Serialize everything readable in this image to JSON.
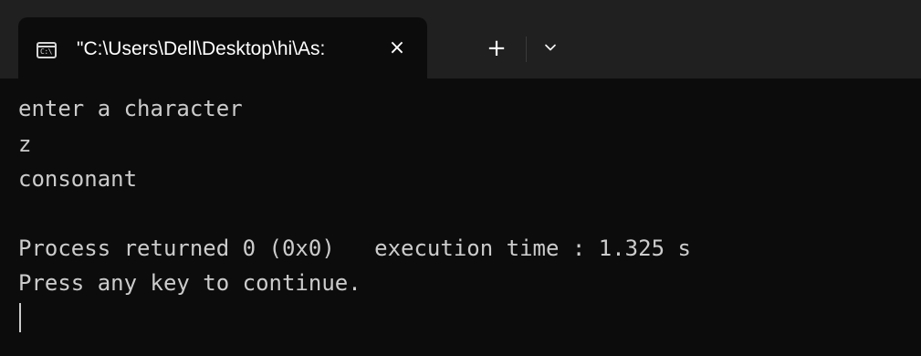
{
  "window": {
    "tab": {
      "title": "\"C:\\Users\\Dell\\Desktop\\hi\\As:",
      "icon_glyph": "C:\\",
      "icon": "console-icon",
      "close_glyph": "×"
    },
    "new_tab_glyph": "+",
    "dropdown_icon": "chevron-down-icon"
  },
  "console": {
    "lines": [
      "enter a character",
      "z",
      "consonant",
      "",
      "Process returned 0 (0x0)   execution time : 1.325 s",
      "Press any key to continue."
    ]
  },
  "colors": {
    "titlebar": "#202020",
    "background": "#0c0c0c",
    "text": "#cccccc"
  }
}
